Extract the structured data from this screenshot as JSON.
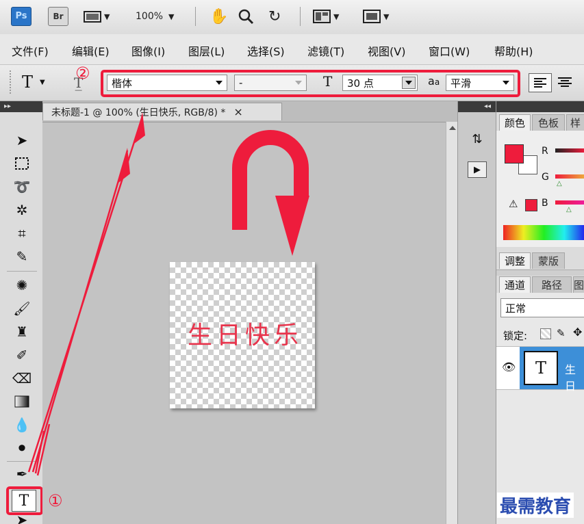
{
  "appbar": {
    "ps_logo": "Ps",
    "br_logo": "Br",
    "zoom": "100%",
    "colors": {
      "ps_blue": "#2a75c8",
      "highlight": "#ee1c3c"
    }
  },
  "menu": [
    "文件(F)",
    "编辑(E)",
    "图像(I)",
    "图层(L)",
    "选择(S)",
    "滤镜(T)",
    "视图(V)",
    "窗口(W)",
    "帮助(H)"
  ],
  "options": {
    "tool_glyph": "T",
    "font_family": "楷体",
    "font_style": "-",
    "font_size": "30 点",
    "antialias_glyph": "a",
    "antialias_sub": "a",
    "antialias": "平滑"
  },
  "document": {
    "tab_title": "未标题-1 @ 100% (生日快乐, RGB/8) *",
    "close_glyph": "×",
    "canvas_text": "生日快乐"
  },
  "panels": {
    "color_tabs": [
      "颜色",
      "色板",
      "样"
    ],
    "channels": [
      "R",
      "G",
      "B"
    ],
    "adjust_tabs": [
      "调整",
      "蒙版"
    ],
    "layer_tabs": [
      "通道",
      "路径",
      "图"
    ],
    "blend_mode": "正常",
    "lock_label": "锁定:",
    "layer_thumb": "T",
    "layer_name": "生日"
  },
  "annotations": {
    "step1": "①",
    "step2": "②"
  },
  "watermark": "最需教育"
}
